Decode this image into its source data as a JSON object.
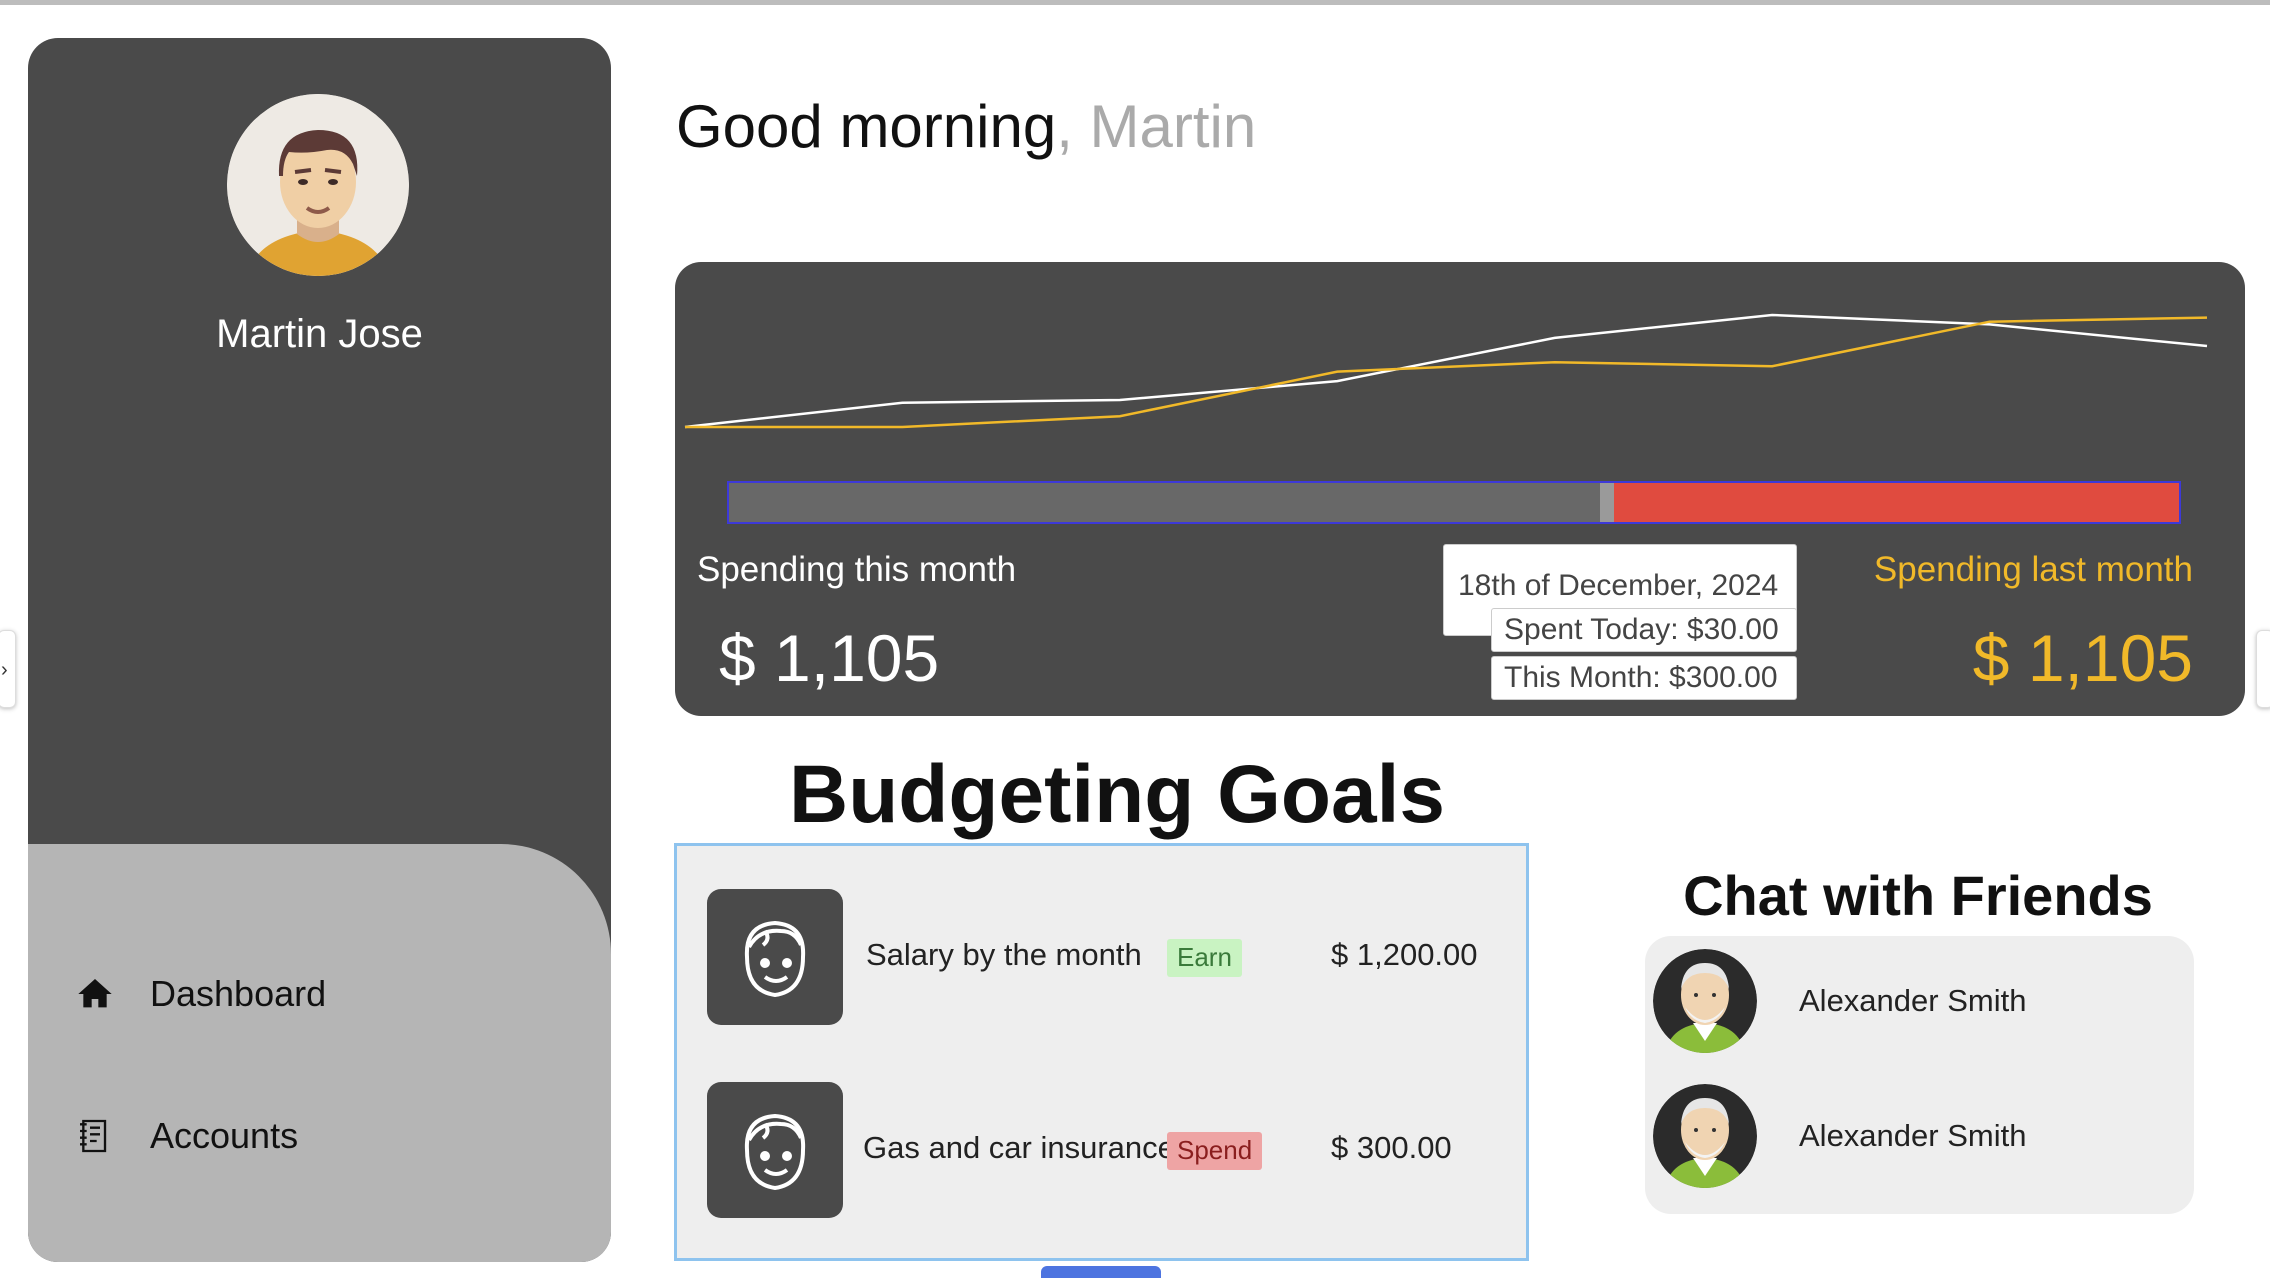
{
  "user": {
    "name": "Martin Jose"
  },
  "nav": {
    "items": [
      {
        "label": "Dashboard",
        "icon": "home-icon"
      },
      {
        "label": "Accounts",
        "icon": "ledger-icon"
      }
    ]
  },
  "greeting": {
    "text": "Good morning",
    "name": ", Martin"
  },
  "spending": {
    "this_month_label": "Spending this month",
    "this_month_amount": "$ 1,105",
    "last_month_label": "Spending last month",
    "last_month_amount": "$ 1,105",
    "progress_fraction": 0.605,
    "tooltip": {
      "date": "18th of December, 2024",
      "spent_today": "Spent Today: $30.00",
      "this_month": "This Month: $300.00"
    },
    "colors": {
      "this_month": "#ffffff",
      "last_month": "#f1b929",
      "over_budget": "#e04b3f",
      "track": "#686868"
    }
  },
  "chart_data": {
    "type": "line",
    "x": [
      0,
      1,
      2,
      3,
      4,
      5,
      6,
      7
    ],
    "series": [
      {
        "values": [
          0,
          18,
          20,
          34,
          66,
          83,
          76,
          60
        ],
        "color": "#ffffff"
      },
      {
        "values": [
          0,
          0,
          8,
          41,
          48,
          45,
          78,
          81
        ],
        "color": "#f1b929"
      }
    ],
    "ylim": [
      0,
      100
    ]
  },
  "goals": {
    "title": "Budgeting Goals",
    "items": [
      {
        "label": "Salary by the month",
        "badge": "Earn",
        "badge_bg": "#c9f3c2",
        "badge_fg": "#3a7a3a",
        "amount": "$ 1,200.00"
      },
      {
        "label": "Gas and car insurance",
        "badge": "Spend",
        "badge_bg": "#eea4a4",
        "badge_fg": "#8a1e1e",
        "amount": "$ 300.00"
      }
    ]
  },
  "chat": {
    "title": "Chat with Friends",
    "friends": [
      {
        "name": "Alexander Smith"
      },
      {
        "name": "Alexander Smith"
      }
    ]
  }
}
